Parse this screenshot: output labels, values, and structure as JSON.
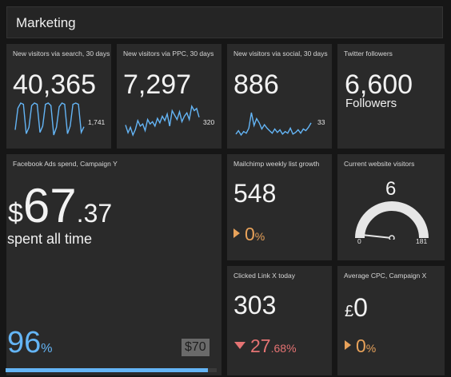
{
  "header": {
    "title": "Marketing"
  },
  "tiles": {
    "search": {
      "title": "New visitors via search, 30 days",
      "value": "40,365",
      "last": "1,741"
    },
    "ppc": {
      "title": "New visitors via PPC, 30 days",
      "value": "7,297",
      "last": "320"
    },
    "social": {
      "title": "New visitors via social, 30 days",
      "value": "886",
      "last": "33"
    },
    "twitter": {
      "title": "Twitter followers",
      "value": "6,600",
      "label": "Followers"
    },
    "facebook": {
      "title": "Facebook Ads spend, Campaign Y",
      "currency": "$",
      "amount_int": "67",
      "amount_dec": ".37",
      "caption": "spent all time",
      "percent": "96",
      "percent_unit": "%",
      "target": "$70",
      "progress": 0.96
    },
    "mailchimp": {
      "title": "Mailchimp weekly list growth",
      "value": "548",
      "change": "0",
      "change_unit": "%"
    },
    "current": {
      "title": "Current website visitors",
      "value": "6",
      "min": "0",
      "max": "181",
      "level": 6
    },
    "clicked": {
      "title": "Clicked Link X today",
      "value": "303",
      "change_int": "27",
      "change_dec": ".68",
      "change_unit": "%"
    },
    "cpc": {
      "title": "Average CPC, Campaign X",
      "currency": "£",
      "value": "0",
      "change": "0",
      "change_unit": "%"
    }
  },
  "colors": {
    "accent": "#64b5f6",
    "neutral": "#e8a25a",
    "negative": "#e57373",
    "tile": "#2a2a2a"
  },
  "sparklines": {
    "search": [
      1500,
      3200,
      3600,
      3500,
      1200,
      1700,
      3400,
      3600,
      3500,
      1300,
      1800,
      3500,
      3600,
      3400,
      1100,
      1700,
      3300,
      3600,
      3500,
      1200,
      1800,
      3500,
      3600,
      3500,
      1300,
      1741
    ],
    "ppc": [
      250,
      180,
      230,
      160,
      210,
      290,
      240,
      260,
      200,
      300,
      260,
      280,
      240,
      310,
      270,
      330,
      290,
      350,
      240,
      380,
      340,
      300,
      370,
      280,
      330,
      360,
      300,
      420,
      380,
      400,
      320
    ],
    "social": [
      20,
      24,
      19,
      23,
      21,
      27,
      45,
      30,
      38,
      33,
      26,
      31,
      27,
      24,
      21,
      26,
      22,
      25,
      20,
      23,
      21,
      27,
      20,
      22,
      25,
      21,
      26,
      24,
      28,
      33
    ]
  }
}
